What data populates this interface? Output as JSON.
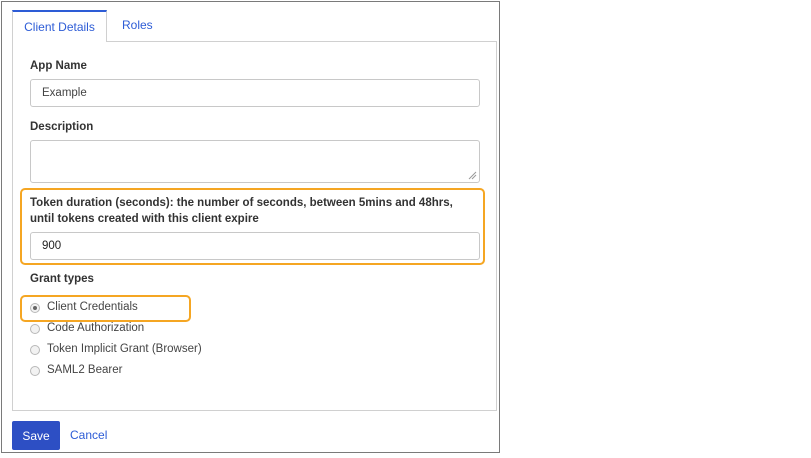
{
  "tabs": [
    {
      "label": "Client Details",
      "active": true
    },
    {
      "label": "Roles",
      "active": false
    }
  ],
  "form": {
    "app_name": {
      "label": "App Name",
      "value": "Example"
    },
    "description": {
      "label": "Description",
      "value": ""
    },
    "token_duration": {
      "label": "Token duration (seconds): the number of seconds, between 5mins and 48hrs, until tokens created with this client expire",
      "value": "900"
    },
    "grant_types": {
      "label": "Grant types",
      "options": [
        {
          "label": "Client Credentials",
          "selected": true
        },
        {
          "label": "Code Authorization",
          "selected": false
        },
        {
          "label": "Token Implicit Grant (Browser)",
          "selected": false
        },
        {
          "label": "SAML2 Bearer",
          "selected": false
        }
      ]
    }
  },
  "actions": {
    "save_label": "Save",
    "cancel_label": "Cancel"
  },
  "colors": {
    "accent": "#2d5cd6",
    "save_button": "#2d4fc4",
    "highlight": "#f5a623"
  }
}
